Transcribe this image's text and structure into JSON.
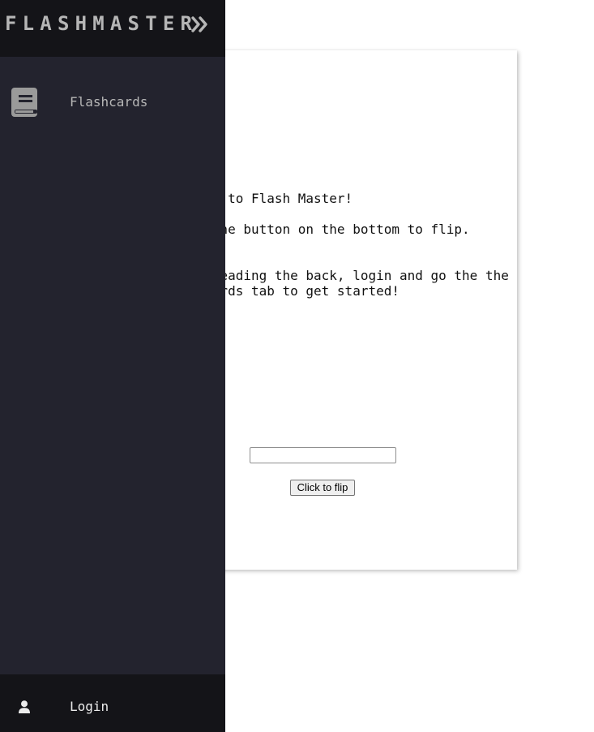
{
  "app": {
    "brand": "FLASHMASTER"
  },
  "sidebar": {
    "items": [
      {
        "label": "Flashcards",
        "icon": "book-icon"
      }
    ],
    "collapse_icon": "double-chevron-right-icon",
    "footer": {
      "label": "Login",
      "icon": "user-icon"
    }
  },
  "card": {
    "lines": [
      "Welcome to Flash Master!",
      "Click the button on the bottom to flip.",
      "After reading the back, login and go the the",
      "Flashcards tab to get started!"
    ],
    "answer_input_value": "",
    "flip_button_label": "Click to flip"
  },
  "colors": {
    "sidebar_background": "#23232e",
    "sidebar_header_background": "#141418",
    "sidebar_text": "#b6b6b6",
    "icon_gray": "#9a9a9a",
    "page_background": "#ffffff"
  }
}
